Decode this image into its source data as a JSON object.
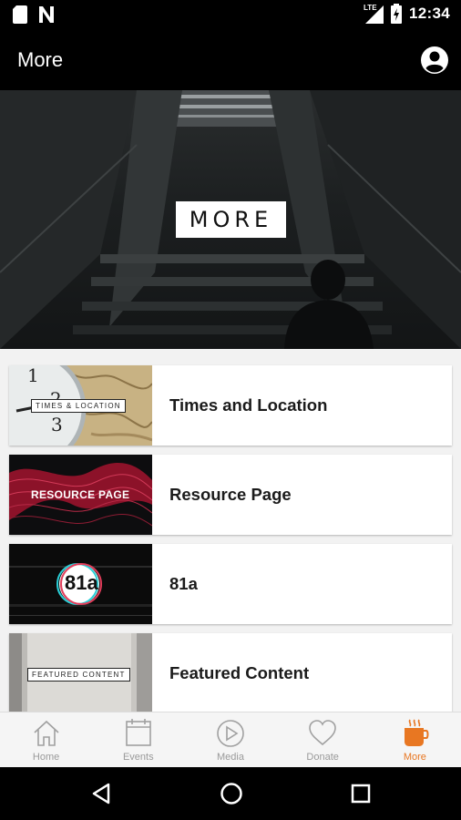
{
  "status_bar": {
    "time": "12:34",
    "network": "LTE",
    "icons": [
      "sd-card-icon",
      "n-notification-icon",
      "signal-icon",
      "battery-icon"
    ]
  },
  "app_bar": {
    "title": "More",
    "profile_icon": "account-circle-icon"
  },
  "hero": {
    "label": "MORE"
  },
  "items": [
    {
      "label": "Times and Location",
      "thumb_text": "TIMES & LOCATION",
      "thumb_icon": "clock-map-thumbnail"
    },
    {
      "label": "Resource Page",
      "thumb_text": "RESOURCE PAGE",
      "thumb_icon": "red-wave-thumbnail"
    },
    {
      "label": "81a",
      "thumb_text": "81a",
      "thumb_icon": "81a-logo-thumbnail"
    },
    {
      "label": "Featured Content",
      "thumb_text": "FEATURED CONTENT",
      "thumb_icon": "wall-thumbnail"
    }
  ],
  "bottom_nav": [
    {
      "label": "Home",
      "icon": "home-icon",
      "active": false
    },
    {
      "label": "Events",
      "icon": "calendar-icon",
      "active": false
    },
    {
      "label": "Media",
      "icon": "play-icon",
      "active": false
    },
    {
      "label": "Donate",
      "icon": "heart-icon",
      "active": false
    },
    {
      "label": "More",
      "icon": "coffee-cup-icon",
      "active": true
    }
  ],
  "colors": {
    "accent": "#e87722",
    "nav_inactive": "#9a9a9a",
    "list_background": "#f2f2f2"
  }
}
